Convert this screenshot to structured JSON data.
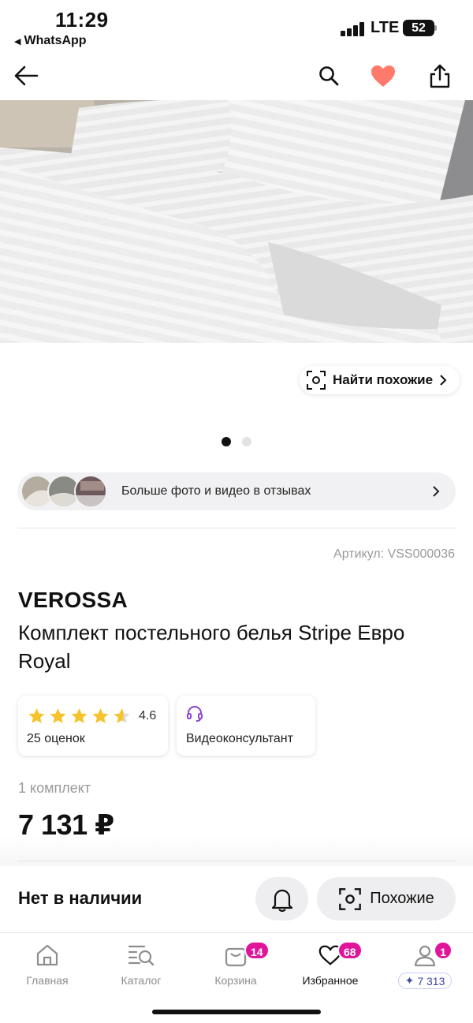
{
  "status_bar": {
    "time": "11:29",
    "back_app": "WhatsApp",
    "network": "LTE",
    "battery": "52"
  },
  "product": {
    "find_similar": "Найти похожие",
    "reviews_media": "Больше фото и видео в отзывах",
    "article": "Артикул: VSS000036",
    "brand": "VEROSSA",
    "title": "Комплект постельного белья Stripe Евро Royal",
    "rating": "4.6",
    "rating_stars": 4.6,
    "reviews_count": "25 оценок",
    "video_consult": "Видеоконсультант",
    "unit": "1 комплект",
    "price": "7 131 ₽"
  },
  "actions": {
    "stock": "Нет в наличии",
    "similar": "Похожие"
  },
  "tabbar": {
    "home": "Главная",
    "catalog": "Каталог",
    "cart": "Корзина",
    "cart_badge": "14",
    "favorites": "Избранное",
    "favorites_badge": "68",
    "profile_badge": "1",
    "points": "7 313"
  },
  "colors": {
    "accent": "#e0159a",
    "heart": "#ff7a6b",
    "star": "#f6c32c"
  }
}
